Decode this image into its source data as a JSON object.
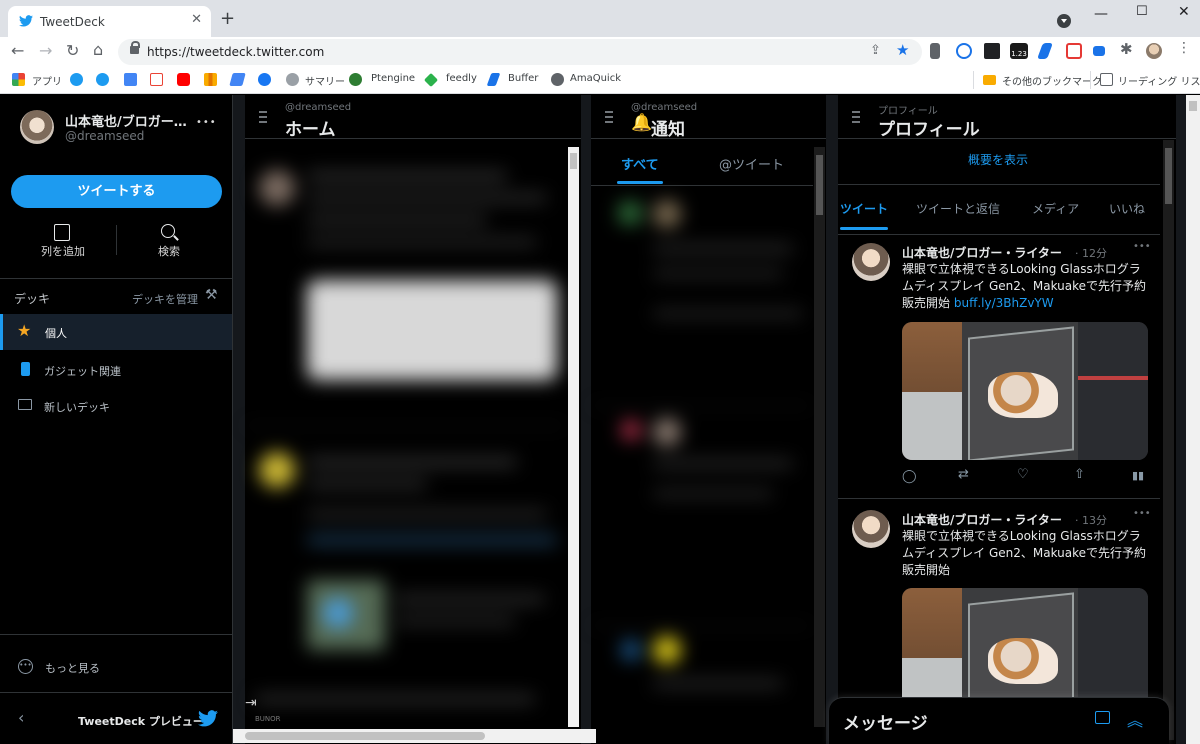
{
  "browser": {
    "tab_title": "TweetDeck",
    "url": "https://tweetdeck.twitter.com",
    "ext_badge": "1.23",
    "bookmarks": [
      "アプリ",
      "サマリー",
      "Ptengine",
      "feedly",
      "Buffer",
      "AmaQuick"
    ],
    "other_bookmarks": "その他のブックマーク",
    "reading_list": "リーディング リスト"
  },
  "sidebar": {
    "name": "山本竜也/ブロガー…",
    "handle": "@dreamseed",
    "more": "•••",
    "tweet_button": "ツイートする",
    "add_column": "列を追加",
    "search": "検索",
    "decks_label": "デッキ",
    "manage_decks": "デッキを管理",
    "decks": [
      "個人",
      "ガジェット関連",
      "新しいデッキ"
    ],
    "show_more": "もっと見る",
    "preview_label": "TweetDeck プレビュー"
  },
  "columns": {
    "home": {
      "account": "@dreamseed",
      "title": "ホーム",
      "blurred_footer": "BUNOR"
    },
    "notifications": {
      "account": "@dreamseed",
      "title": "通知",
      "tabs": [
        "すべて",
        "@ツイート"
      ]
    },
    "profile": {
      "account": "プロフィール",
      "title": "プロフィール",
      "show_overview": "概要を表示",
      "tabs": [
        "ツイート",
        "ツイートと返信",
        "メディア",
        "いいね"
      ],
      "tweets": [
        {
          "name": "山本竜也/ブロガー・ライター",
          "time": "· 12分",
          "text": "裸眼で立体視できるLooking Glassホログラムディスプレイ Gen2、Makuakeで先行予約販売開始",
          "link": "buff.ly/3BhZvYW"
        },
        {
          "name": "山本竜也/ブロガー・ライター",
          "time": "· 13分",
          "text": "裸眼で立体視できるLooking Glassホログラムディスプレイ Gen2、Makuakeで先行予約販売開始",
          "link": ""
        }
      ]
    }
  },
  "messages": {
    "label": "メッセージ"
  },
  "colors": {
    "accent": "#1d9bf0",
    "background": "#000000",
    "twitter_blue": "#1d9bf0"
  }
}
